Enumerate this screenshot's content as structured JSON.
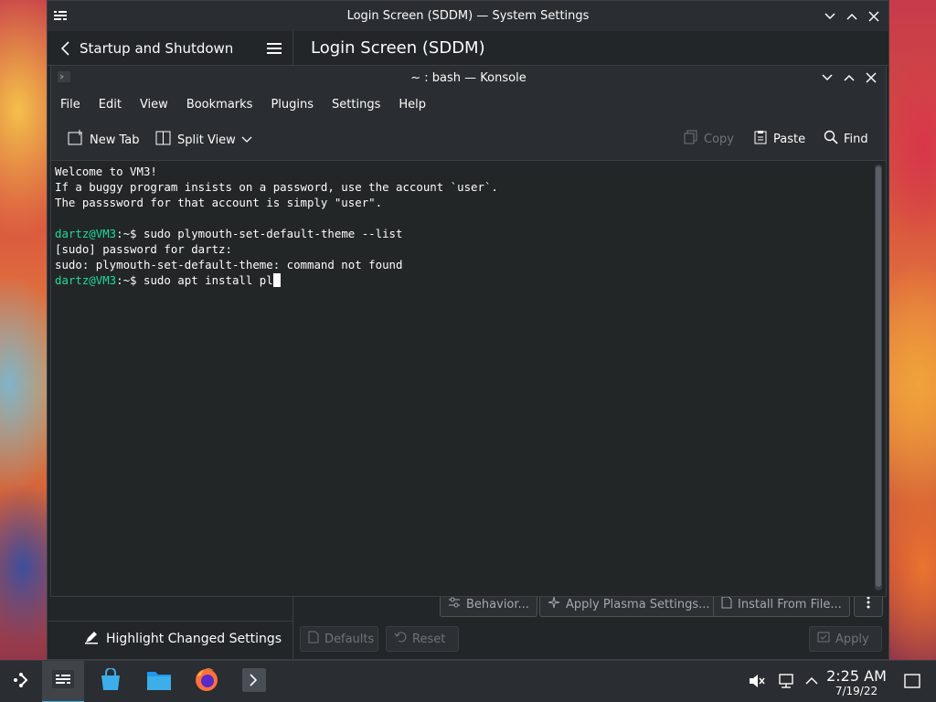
{
  "settings_window": {
    "title": "Login Screen (SDDM) — System Settings",
    "back_label": "Startup and Shutdown",
    "page_title": "Login Screen (SDDM)",
    "buttons": {
      "behavior": "Behavior...",
      "apply_plasma": "Apply Plasma Settings...",
      "install_from_file": "Install From File...",
      "defaults": "Defaults",
      "reset": "Reset",
      "apply": "Apply"
    },
    "highlight_label": "Highlight Changed Settings"
  },
  "konsole_window": {
    "title": "~ : bash — Konsole",
    "menu": [
      "File",
      "Edit",
      "View",
      "Bookmarks",
      "Plugins",
      "Settings",
      "Help"
    ],
    "toolbar": {
      "new_tab": "New Tab",
      "split_view": "Split View",
      "copy": "Copy",
      "paste": "Paste",
      "find": "Find"
    },
    "terminal": {
      "lines": [
        "Welcome to VM3!",
        "If a buggy program insists on a password, use the account `user`.",
        "The passsword for that account is simply \"user\".",
        "",
        "[sudo] password for dartz:",
        "sudo: plymouth-set-default-theme: command not found"
      ],
      "prompt_user": "dartz@VM3",
      "prompt_path": ":~$",
      "command1": " sudo plymouth-set-default-theme --list",
      "command2": " sudo apt install pl"
    }
  },
  "taskbar": {
    "time": "2:25 AM",
    "date": "7/19/22",
    "apps": [
      "application-launcher-icon",
      "system-settings-icon",
      "discover-icon",
      "file-manager-icon",
      "firefox-icon",
      "konsole-icon"
    ]
  },
  "colors": {
    "accent": "#3daee9",
    "prompt": "#1cdc9a",
    "window_bg": "#232629"
  }
}
